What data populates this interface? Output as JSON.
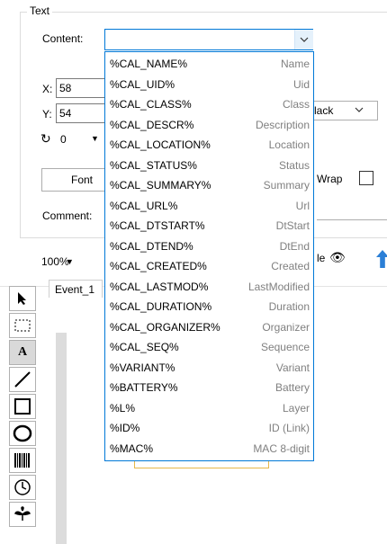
{
  "group": {
    "title": "Text"
  },
  "content": {
    "label": "Content:",
    "value": ""
  },
  "position": {
    "x_label": "X:",
    "x_value": "58",
    "y_label": "Y:",
    "y_value": "54"
  },
  "rotation": {
    "value": "0"
  },
  "color": {
    "value": "lack"
  },
  "font": {
    "button_label": "Font"
  },
  "wrap": {
    "label": "Wrap",
    "checked": false
  },
  "comment": {
    "label": "Comment:"
  },
  "view": {
    "zoom": "100%",
    "eye_label": "le"
  },
  "tab": {
    "label": "Event_1"
  },
  "dropdown": {
    "items": [
      {
        "key": "%CAL_NAME%",
        "desc": "Name"
      },
      {
        "key": "%CAL_UID%",
        "desc": "Uid"
      },
      {
        "key": "%CAL_CLASS%",
        "desc": "Class"
      },
      {
        "key": "%CAL_DESCR%",
        "desc": "Description"
      },
      {
        "key": "%CAL_LOCATION%",
        "desc": "Location"
      },
      {
        "key": "%CAL_STATUS%",
        "desc": "Status"
      },
      {
        "key": "%CAL_SUMMARY%",
        "desc": "Summary"
      },
      {
        "key": "%CAL_URL%",
        "desc": "Url"
      },
      {
        "key": "%CAL_DTSTART%",
        "desc": "DtStart"
      },
      {
        "key": "%CAL_DTEND%",
        "desc": "DtEnd"
      },
      {
        "key": "%CAL_CREATED%",
        "desc": "Created"
      },
      {
        "key": "%CAL_LASTMOD%",
        "desc": "LastModified"
      },
      {
        "key": "%CAL_DURATION%",
        "desc": "Duration"
      },
      {
        "key": "%CAL_ORGANIZER%",
        "desc": "Organizer"
      },
      {
        "key": "%CAL_SEQ%",
        "desc": "Sequence"
      },
      {
        "key": "%VARIANT%",
        "desc": "Variant"
      },
      {
        "key": "%BATTERY%",
        "desc": "Battery"
      },
      {
        "key": "%L%",
        "desc": "Layer"
      },
      {
        "key": "%ID%",
        "desc": "ID (Link)"
      },
      {
        "key": "%MAC%",
        "desc": "MAC 8-digit"
      }
    ]
  },
  "toolbox": {
    "tools": [
      {
        "name": "select-tool",
        "icon": "arrow-pointer-icon"
      },
      {
        "name": "marquee-tool",
        "icon": "dotted-rectangle-icon"
      },
      {
        "name": "text-tool",
        "icon": "letter-a-icon",
        "glyph": "A"
      },
      {
        "name": "line-tool",
        "icon": "diagonal-line-icon"
      },
      {
        "name": "rectangle-tool",
        "icon": "square-icon"
      },
      {
        "name": "ellipse-tool",
        "icon": "circle-icon"
      },
      {
        "name": "barcode-tool",
        "icon": "barcode-icon"
      },
      {
        "name": "clock-tool",
        "icon": "clock-icon"
      },
      {
        "name": "symbol-tool",
        "icon": "leaf-icon"
      }
    ]
  },
  "colors": {
    "accent": "#0078d7",
    "desc_gray": "#808080"
  }
}
